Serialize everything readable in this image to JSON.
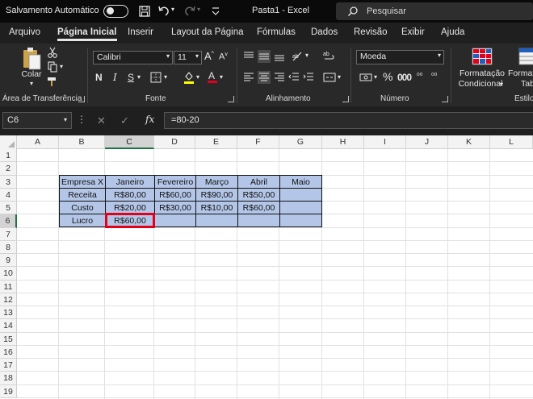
{
  "titlebar": {
    "autosave_label": "Salvamento Automático",
    "doc_title": "Pasta1  -  Excel",
    "search_placeholder": "Pesquisar"
  },
  "menu_tabs": [
    "Arquivo",
    "Página Inicial",
    "Inserir",
    "Layout da Página",
    "Fórmulas",
    "Dados",
    "Revisão",
    "Exibir",
    "Ajuda"
  ],
  "active_tab": "Página Inicial",
  "ribbon": {
    "clipboard": {
      "paste_label": "Colar",
      "group_label": "Área de Transferência"
    },
    "font": {
      "font_name": "Calibri",
      "font_size": "11",
      "bold": "N",
      "italic": "I",
      "underline": "S",
      "group_label": "Fonte"
    },
    "alignment": {
      "group_label": "Alinhamento"
    },
    "number": {
      "format": "Moeda",
      "percent": "%",
      "group_label": "Número"
    },
    "styles": {
      "conditional_label_1": "Formatação",
      "conditional_label_2": "Condicional",
      "table_label_1": "Format",
      "table_label_2": "Tab",
      "group_label": "Estilo"
    }
  },
  "formula_bar": {
    "name_box": "C6",
    "formula": "=80-20"
  },
  "columns": [
    "A",
    "B",
    "C",
    "D",
    "E",
    "F",
    "G",
    "H",
    "I",
    "J",
    "K",
    "L"
  ],
  "rows": [
    "1",
    "2",
    "3",
    "4",
    "5",
    "6",
    "7",
    "8",
    "9",
    "10",
    "11",
    "12",
    "13",
    "14",
    "15",
    "16",
    "17",
    "18",
    "19"
  ],
  "table": {
    "header": [
      "Empresa X",
      "Janeiro",
      "Fevereiro",
      "Março",
      "Abril",
      "Maio"
    ],
    "rows": [
      [
        "Receita",
        "R$80,00",
        "R$60,00",
        "R$90,00",
        "R$50,00",
        ""
      ],
      [
        "Custo",
        "R$20,00",
        "R$30,00",
        "R$10,00",
        "R$60,00",
        ""
      ],
      [
        "Lucro",
        "R$60,00",
        "",
        "",
        "",
        ""
      ]
    ]
  },
  "colors": {
    "table_fill": "#b4c6e7",
    "selection_border": "#e3001b",
    "accent": "#217346"
  }
}
